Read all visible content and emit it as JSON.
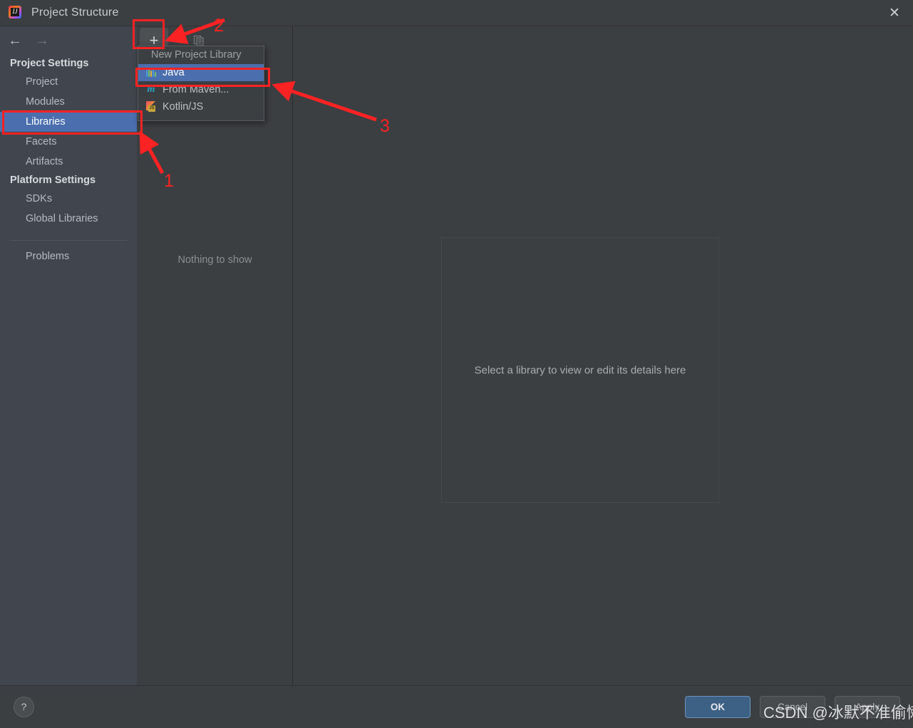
{
  "window": {
    "title": "Project Structure",
    "app_icon": "intellij-idea-icon",
    "close_label": "✕"
  },
  "navigation": {
    "back_icon": "←",
    "forward_icon": "→"
  },
  "sidebar": {
    "groups": [
      {
        "label": "Project Settings",
        "items": [
          {
            "label": "Project",
            "selected": false
          },
          {
            "label": "Modules",
            "selected": false
          },
          {
            "label": "Libraries",
            "selected": true
          },
          {
            "label": "Facets",
            "selected": false
          },
          {
            "label": "Artifacts",
            "selected": false
          }
        ]
      },
      {
        "label": "Platform Settings",
        "items": [
          {
            "label": "SDKs",
            "selected": false
          },
          {
            "label": "Global Libraries",
            "selected": false
          }
        ]
      }
    ],
    "extra_items": [
      {
        "label": "Problems",
        "selected": false
      }
    ]
  },
  "list_panel": {
    "add_button_label": "+",
    "copy_button_icon": "copy-icon",
    "empty_message": "Nothing to show"
  },
  "dropdown": {
    "header": "New Project Library",
    "items": [
      {
        "label": "Java",
        "icon": "java-icon",
        "selected": true
      },
      {
        "label": "From Maven...",
        "icon": "maven-icon",
        "selected": false
      },
      {
        "label": "Kotlin/JS",
        "icon": "kotlin-js-icon",
        "selected": false
      }
    ]
  },
  "detail_panel": {
    "message": "Select a library to view or edit its details here"
  },
  "footer": {
    "help_label": "?",
    "ok_label": "OK",
    "cancel_label": "Cancel",
    "apply_label": "Apply"
  },
  "annotations": {
    "numbers": [
      "1",
      "2",
      "3"
    ],
    "color": "#fa2222"
  },
  "watermark": {
    "text": "CSDN @冰默不准偷懒"
  }
}
